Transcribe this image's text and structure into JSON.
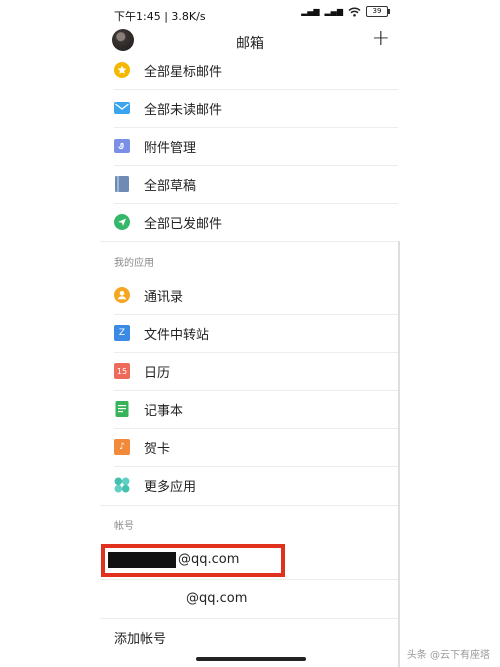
{
  "status_bar": {
    "left_text": "下午1:45 | 3.8K/s",
    "battery": "39",
    "signal_label": "HD"
  },
  "header": {
    "title": "邮箱",
    "add_symbol": "+"
  },
  "mail_items": [
    {
      "label": "全部星标邮件",
      "icon": "star-icon",
      "color": "#F5B800"
    },
    {
      "label": "全部未读邮件",
      "icon": "envelope-icon",
      "color": "#3AA4EE"
    },
    {
      "label": "附件管理",
      "icon": "attachment-icon",
      "color": "#7C8FE6"
    },
    {
      "label": "全部草稿",
      "icon": "draft-icon",
      "color": "#6E8BB3"
    },
    {
      "label": "全部已发邮件",
      "icon": "send-icon",
      "color": "#36B86A"
    }
  ],
  "apps_section": {
    "label": "我的应用",
    "items": [
      {
        "label": "通讯录",
        "icon": "contacts-icon",
        "color": "#F5A623"
      },
      {
        "label": "文件中转站",
        "icon": "folder-icon",
        "color": "#3B8AE5",
        "glyph": "Z"
      },
      {
        "label": "日历",
        "icon": "calendar-icon",
        "color": "#EE6A5A",
        "glyph": "15"
      },
      {
        "label": "记事本",
        "icon": "notebook-icon",
        "color": "#38B35A"
      },
      {
        "label": "贺卡",
        "icon": "greeting-card-icon",
        "color": "#F28A3A",
        "glyph": "♪"
      },
      {
        "label": "更多应用",
        "icon": "more-apps-icon",
        "color": "#42C0B0"
      }
    ]
  },
  "accounts_section": {
    "label": "帐号",
    "accounts": [
      {
        "suffix": "@qq.com"
      },
      {
        "suffix": "@qq.com"
      }
    ],
    "add_label": "添加帐号"
  },
  "watermark": "头条 @云下有座塔"
}
